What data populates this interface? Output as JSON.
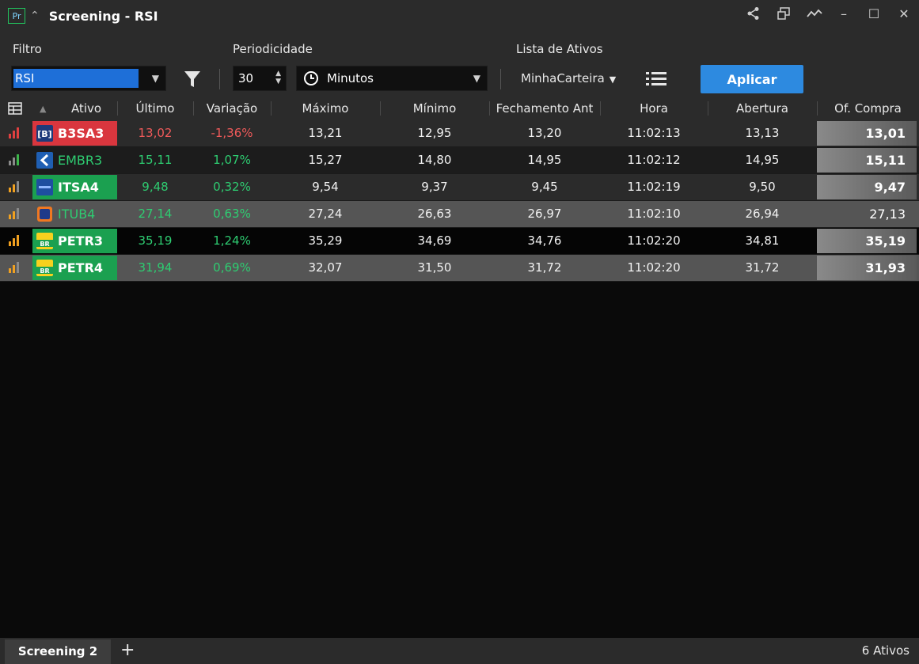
{
  "window": {
    "app_icon": "Pr",
    "title": "Screening - RSI",
    "controls": [
      "share-icon",
      "popout-icon",
      "chart-icon",
      "minimize-icon",
      "maximize-icon",
      "close-icon"
    ]
  },
  "toolbar": {
    "filter_label": "Filtro",
    "filter_value": "RSI",
    "period_label": "Periodicidade",
    "period_value": "30",
    "period_unit": "Minutos",
    "list_label": "Lista de Ativos",
    "list_value": "MinhaCarteira",
    "apply_label": "Aplicar",
    "apply_color": "#2d8ae0"
  },
  "table": {
    "columns": {
      "ativo": "Ativo",
      "ultimo": "Último",
      "variacao": "Variação",
      "maximo": "Máximo",
      "minimo": "Mínimo",
      "fechamento": "Fechamento Ant",
      "hora": "Hora",
      "abertura": "Abertura",
      "of_compra": "Of. Compra"
    },
    "rows": [
      {
        "ativo": "B3SA3",
        "ultimo": "13,02",
        "variacao": "-1,36%",
        "maximo": "13,21",
        "minimo": "12,95",
        "fechamento": "13,20",
        "hora": "11:02:13",
        "abertura": "13,13",
        "of_compra": "13,01"
      },
      {
        "ativo": "EMBR3",
        "ultimo": "15,11",
        "variacao": "1,07%",
        "maximo": "15,27",
        "minimo": "14,80",
        "fechamento": "14,95",
        "hora": "11:02:12",
        "abertura": "14,95",
        "of_compra": "15,11"
      },
      {
        "ativo": "ITSA4",
        "ultimo": "9,48",
        "variacao": "0,32%",
        "maximo": "9,54",
        "minimo": "9,37",
        "fechamento": "9,45",
        "hora": "11:02:19",
        "abertura": "9,50",
        "of_compra": "9,47"
      },
      {
        "ativo": "ITUB4",
        "ultimo": "27,14",
        "variacao": "0,63%",
        "maximo": "27,24",
        "minimo": "26,63",
        "fechamento": "26,97",
        "hora": "11:02:10",
        "abertura": "26,94",
        "of_compra": "27,13"
      },
      {
        "ativo": "PETR3",
        "ultimo": "35,19",
        "variacao": "1,24%",
        "maximo": "35,29",
        "minimo": "34,69",
        "fechamento": "34,76",
        "hora": "11:02:20",
        "abertura": "34,81",
        "of_compra": "35,19"
      },
      {
        "ativo": "PETR4",
        "ultimo": "31,94",
        "variacao": "0,69%",
        "maximo": "32,07",
        "minimo": "31,50",
        "fechamento": "31,72",
        "hora": "11:02:20",
        "abertura": "31,72",
        "of_compra": "31,93"
      }
    ]
  },
  "footer": {
    "tab_label": "Screening 2",
    "count_label": "6 Ativos"
  },
  "colors": {
    "negative": "#f05a5a",
    "positive": "#2ecc71",
    "row_red": "#d9363e",
    "row_green": "#1ba050"
  }
}
